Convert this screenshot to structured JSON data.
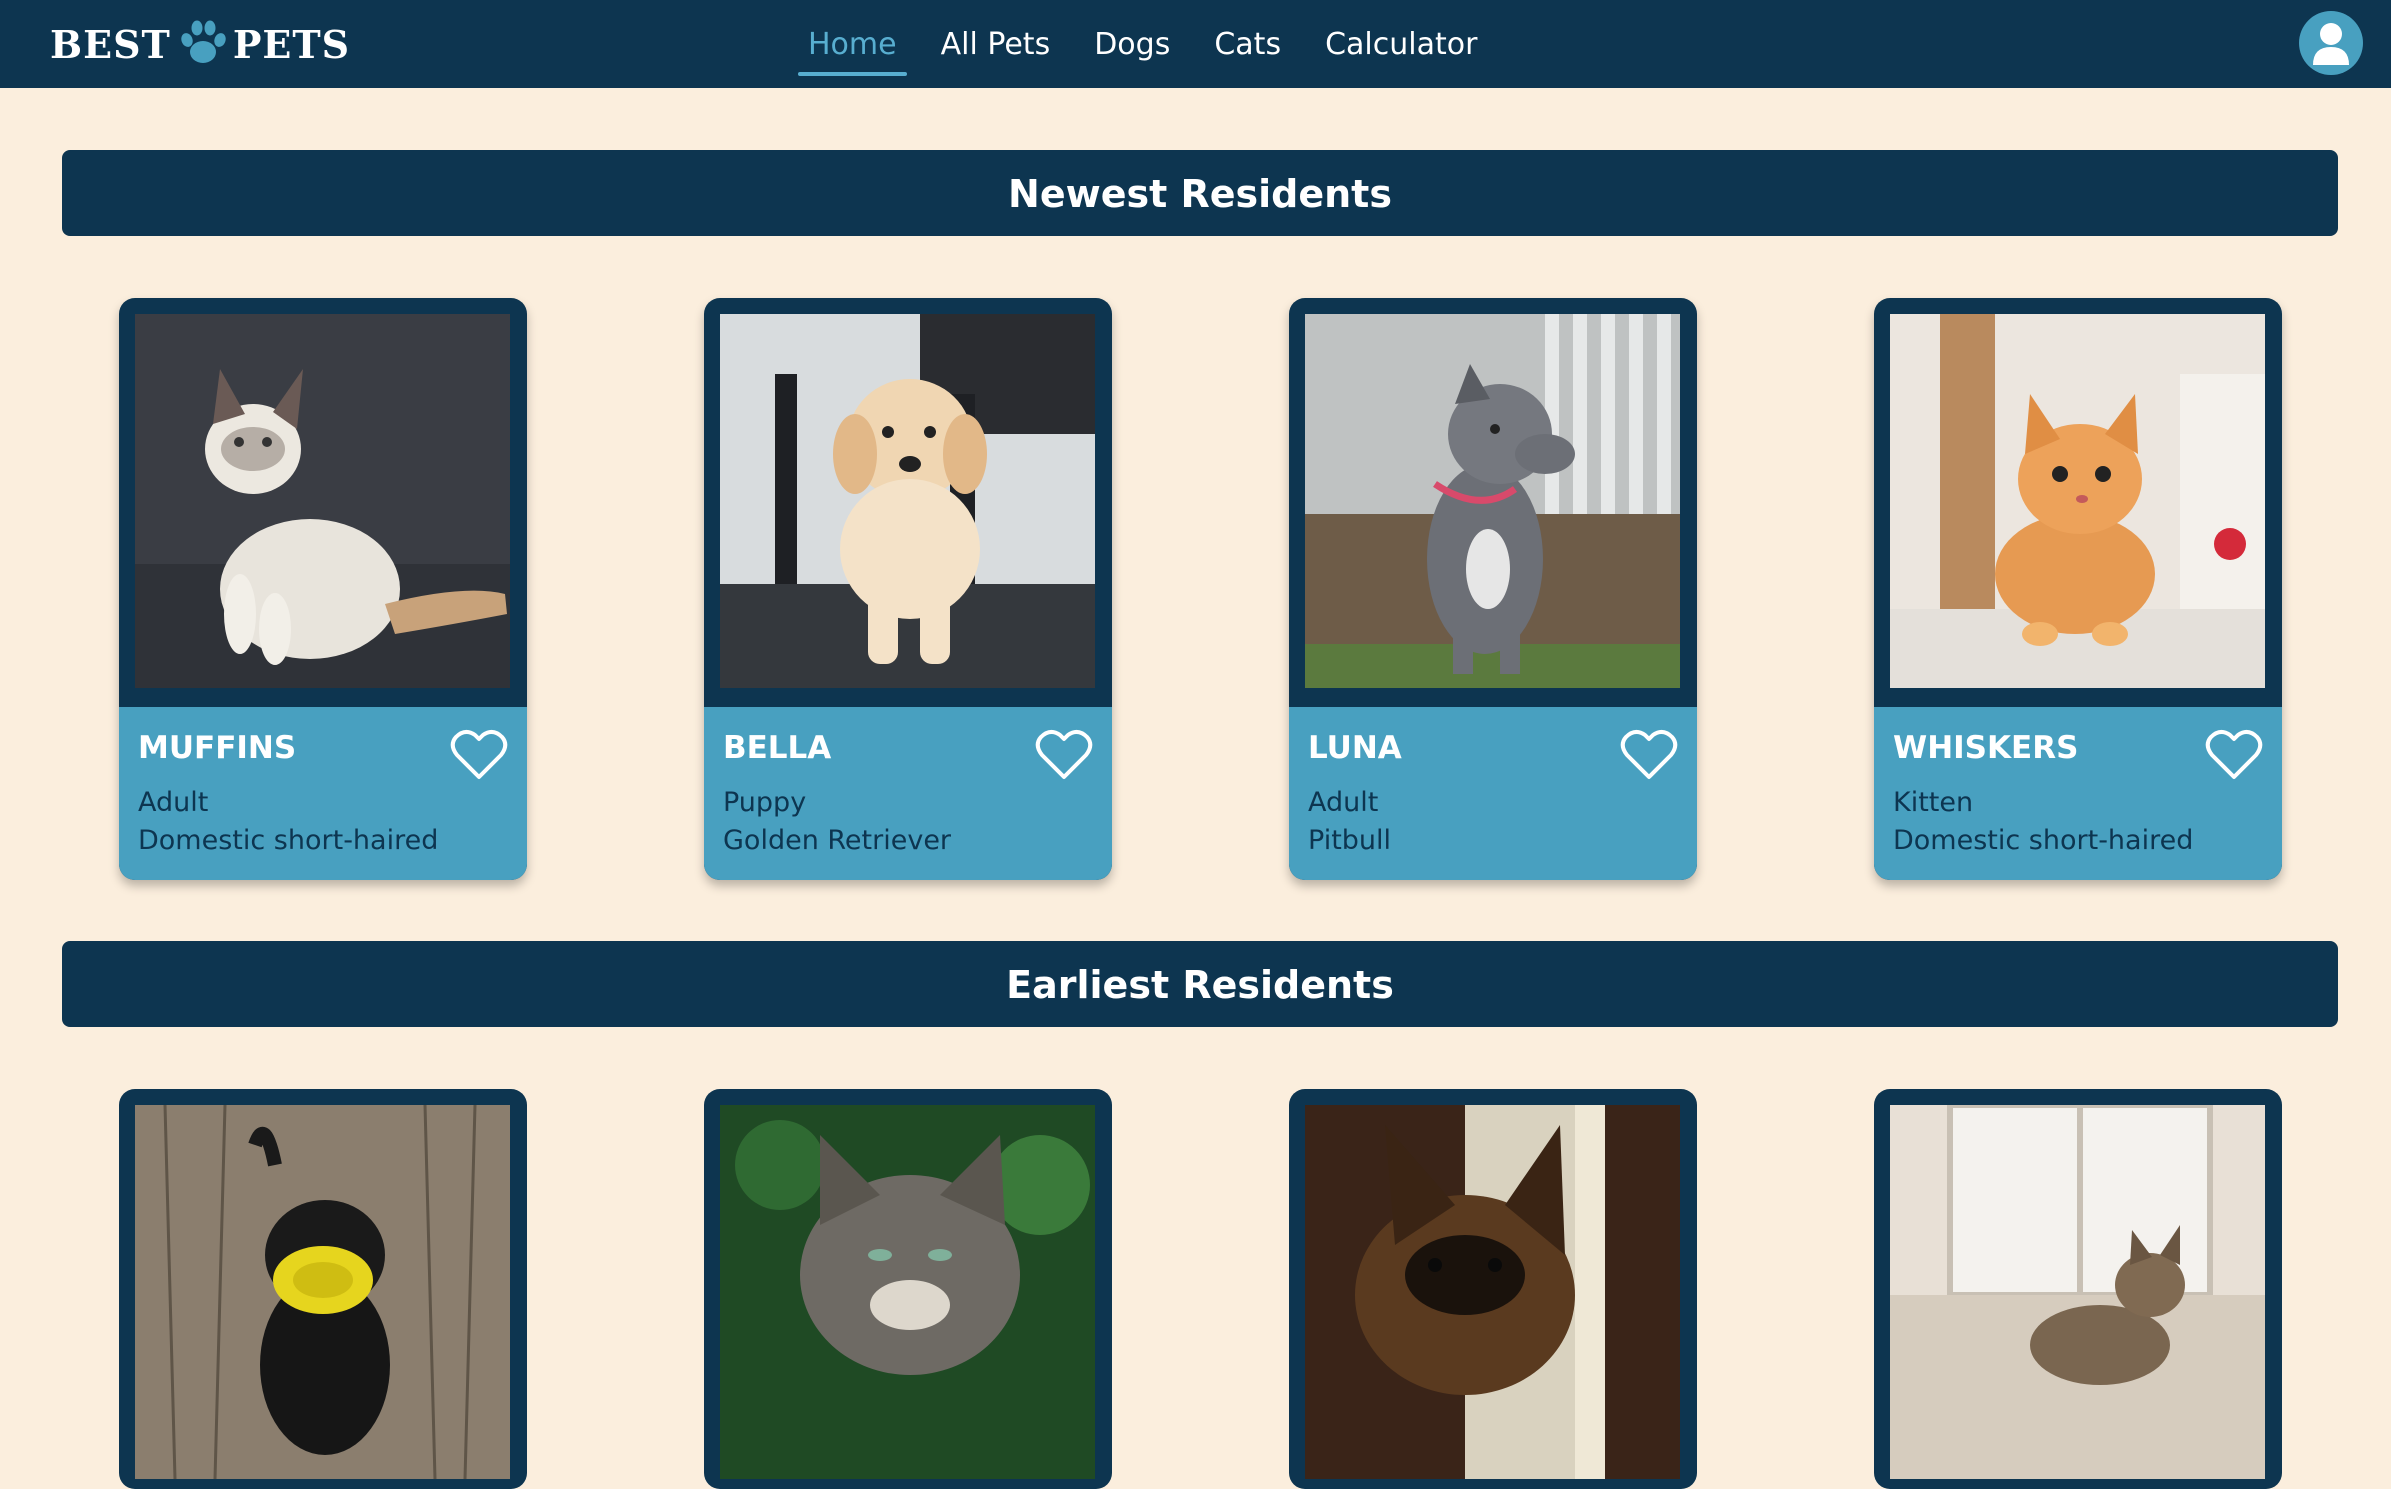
{
  "brand": {
    "left": "BEST",
    "right": "PETS",
    "icon": "paw-icon"
  },
  "nav": {
    "items": [
      {
        "label": "Home",
        "active": true
      },
      {
        "label": "All Pets",
        "active": false
      },
      {
        "label": "Dogs",
        "active": false
      },
      {
        "label": "Cats",
        "active": false
      },
      {
        "label": "Calculator",
        "active": false
      }
    ],
    "profile_icon": "user-avatar-icon"
  },
  "sections": {
    "newest": {
      "title": "Newest Residents",
      "pets": [
        {
          "name": "MUFFINS",
          "age": "Adult",
          "breed": "Domestic short-haired",
          "photo": "white-cat-photo",
          "favorite_icon": "heart-outline-icon"
        },
        {
          "name": "BELLA",
          "age": "Puppy",
          "breed": "Golden Retriever",
          "photo": "golden-puppy-photo",
          "favorite_icon": "heart-outline-icon"
        },
        {
          "name": "LUNA",
          "age": "Adult",
          "breed": "Pitbull",
          "photo": "grey-pitbull-photo",
          "favorite_icon": "heart-outline-icon"
        },
        {
          "name": "WHISKERS",
          "age": "Kitten",
          "breed": "Domestic short-haired",
          "photo": "orange-kitten-photo",
          "favorite_icon": "heart-outline-icon"
        }
      ]
    },
    "earliest": {
      "title": "Earliest Residents",
      "pets": [
        {
          "photo": "black-dog-frisbee-photo"
        },
        {
          "photo": "tabby-cat-photo"
        },
        {
          "photo": "german-shepherd-photo"
        },
        {
          "photo": "tabby-kitten-window-photo"
        }
      ]
    }
  },
  "colors": {
    "navy": "#0d3550",
    "teal": "#48a0c0",
    "active_link": "#58aed0",
    "background": "#fbeedd",
    "text_dark": "#0d3550",
    "text_light": "#ffffff"
  }
}
